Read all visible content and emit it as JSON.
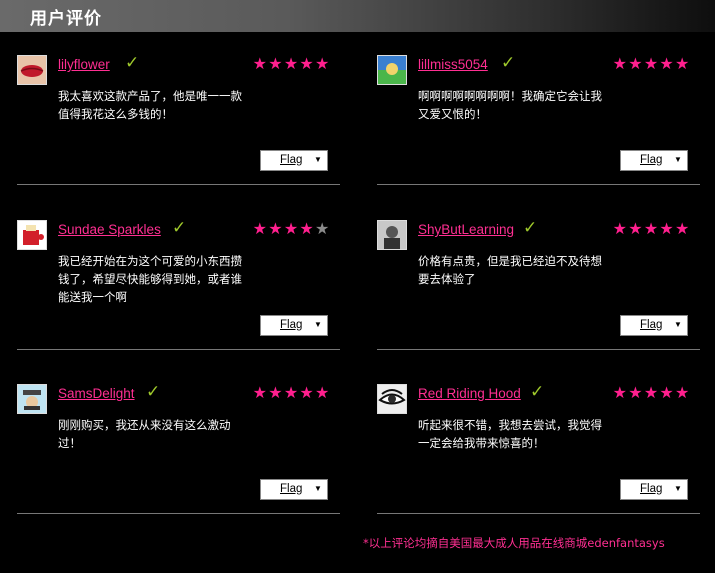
{
  "header": {
    "title": "用户评价"
  },
  "reviews": [
    {
      "username": "lilyflower",
      "rating": 5,
      "text": "我太喜欢这款产品了，他是唯一一款值得我花这么多钱的！",
      "flag_label": "Flag"
    },
    {
      "username": "lillmiss5054",
      "rating": 5,
      "text": "啊啊啊啊啊啊啊啊！我确定它会让我又爱又恨的！",
      "flag_label": "Flag"
    },
    {
      "username": "Sundae Sparkles",
      "rating": 4,
      "text": "我已经开始在为这个可爱的小东西攒钱了，希望尽快能够得到她，或者谁能送我一个啊",
      "flag_label": "Flag"
    },
    {
      "username": "ShyButLearning",
      "rating": 5,
      "text": "价格有点贵，但是我已经迫不及待想要去体验了",
      "flag_label": "Flag"
    },
    {
      "username": "SamsDelight",
      "rating": 5,
      "text": "刚刚购买，我还从来没有这么激动过！",
      "flag_label": "Flag"
    },
    {
      "username": "Red Riding Hood",
      "rating": 5,
      "text": "听起来很不错，我想去尝试，我觉得一定会给我带来惊喜的！",
      "flag_label": "Flag"
    }
  ],
  "footnote": "*以上评论均摘自美国最大成人用品在线商城edenfantasys",
  "colors": {
    "accent": "#ff2f92",
    "check": "#9ec82b",
    "star_on": "#ff1f8e",
    "star_off": "#8a8a8a"
  }
}
